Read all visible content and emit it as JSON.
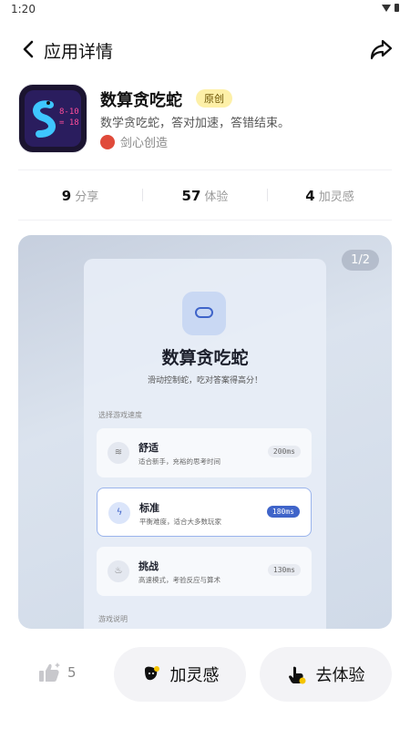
{
  "status": {
    "time": "1:20"
  },
  "nav": {
    "title": "应用详情"
  },
  "app": {
    "name": "数算贪吃蛇",
    "badge": "原创",
    "description": "数学贪吃蛇，答对加速，答错结束。",
    "author": "剑心创造",
    "icon_text_top": "8-10",
    "icon_text_bottom": "= 18"
  },
  "stats": [
    {
      "value": "9",
      "label": "分享"
    },
    {
      "value": "57",
      "label": "体验"
    },
    {
      "value": "4",
      "label": "加灵感"
    }
  ],
  "preview": {
    "page_indicator": "1/2",
    "game_title": "数算贪吃蛇",
    "game_subtitle": "滑动控制蛇，吃对答案得高分！",
    "speed_label": "选择游戏速度",
    "modes": [
      {
        "name": "舒适",
        "desc": "适合新手，充裕的思考时间",
        "time": "200ms",
        "selected": false
      },
      {
        "name": "标准",
        "desc": "平衡难度，适合大多数玩家",
        "time": "180ms",
        "selected": true
      },
      {
        "name": "挑战",
        "desc": "高速模式，考验反应与算术",
        "time": "130ms",
        "selected": false
      }
    ],
    "rules_label": "游戏说明"
  },
  "bottom": {
    "like_count": "5",
    "inspire_label": "加灵感",
    "try_label": "去体验"
  },
  "colors": {
    "accent": "#3f64c9",
    "badge_bg": "#fdf0a8",
    "icon_bg": "#1b1430",
    "icon_digits": "#ff4d9a"
  }
}
